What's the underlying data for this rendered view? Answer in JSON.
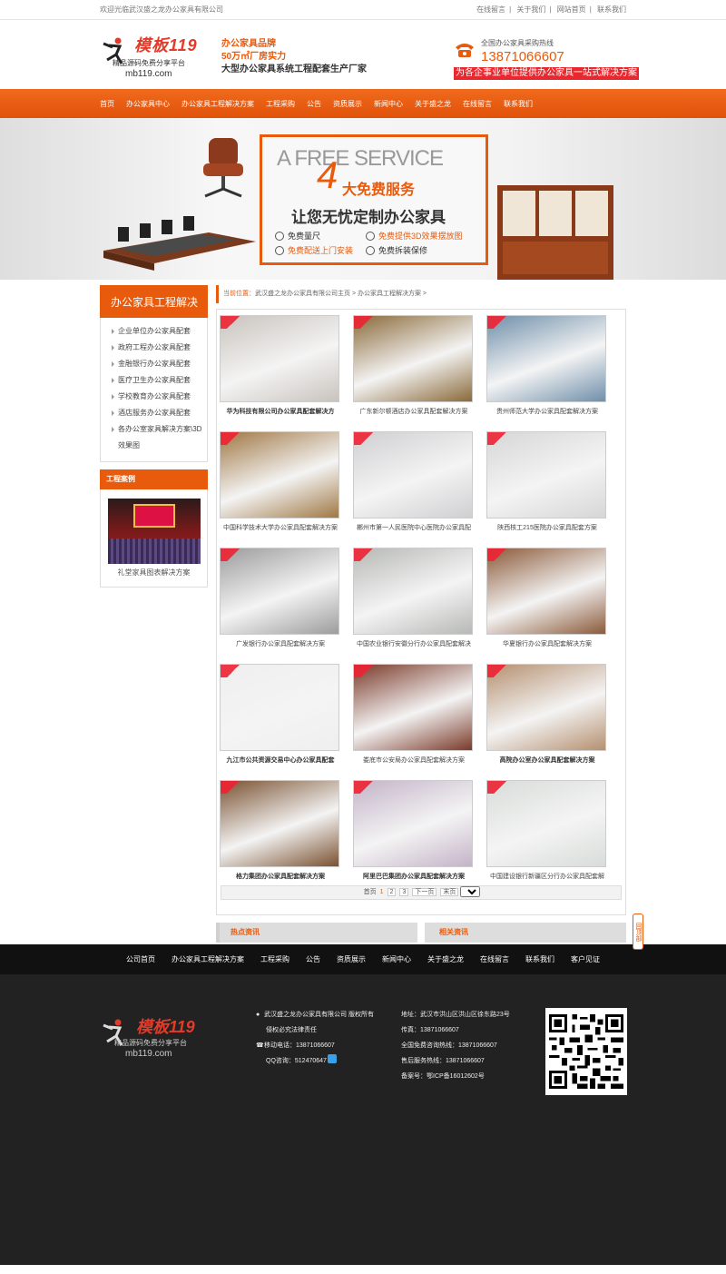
{
  "topbar": {
    "welcome": "欢迎光临武汉盛之龙办公家具有限公司",
    "links": [
      "在线留言",
      "关于我们",
      "网站首页",
      "联系我们"
    ]
  },
  "header": {
    "logo_brand": "模板119",
    "logo_tagline": "精品源码免费分享平台",
    "logo_url": "mb119.com",
    "slogan_line1": "办公家具品牌",
    "slogan_line2": "50万㎡厂房实力",
    "slogan_line3": "大型办公家具系统工程配套生产厂家",
    "hotline_label": "全国办公家具采购热线",
    "hotline_number": "13871066607",
    "hotline_banner": "为各企事业单位提供办公家具一站式解决方案"
  },
  "nav": [
    "首页",
    "办公家具中心",
    "办公家具工程解决方案",
    "工程采购",
    "公告",
    "资质展示",
    "新闻中心",
    "关于盛之龙",
    "在线留言",
    "联系我们"
  ],
  "banner": {
    "free_service": "A FREE SERVICE",
    "four": "4",
    "title": "大免费服务",
    "subtitle": "让您无忧定制办公家具",
    "features": [
      "免费量尺",
      "免费提供3D效果摆放图",
      "免费配送上门安装",
      "免费拆装保修"
    ]
  },
  "sidebar": {
    "title": "办公家具工程解决",
    "items": [
      "企业单位办公家具配套",
      "政府工程办公家具配套",
      "金融银行办公家具配套",
      "医疗卫生办公家具配套",
      "学校教育办公家具配套",
      "酒店服务办公家具配套",
      "各办公室家具解决方案\\3D效果图"
    ],
    "cases_title": "工程案例",
    "case_caption": "礼堂家具图表解决方案"
  },
  "breadcrumb": {
    "here": "当前位置：",
    "path": "武汉盛之龙办公家具有限公司主页 > 办公家具工程解决方案 >"
  },
  "cases": [
    {
      "caption": "华为科技有限公司办公家具配套解决方",
      "bold": true,
      "color": "#c9c3bd"
    },
    {
      "caption": "广东新尔顿酒店办公家具配套解决方案",
      "bold": false,
      "color": "#8a6a3a"
    },
    {
      "caption": "贵州师范大学办公家具配套解决方案",
      "bold": false,
      "color": "#6f8faa"
    },
    {
      "caption": "中国科学技术大学办公家具配套解决方案",
      "bold": false,
      "color": "#a07845"
    },
    {
      "caption": "郴州市第一人民医院中心医院办公家具配",
      "bold": false,
      "color": "#cfcfd2"
    },
    {
      "caption": "陕西核工215医院办公家具配套方案",
      "bold": false,
      "color": "#d6d6d6"
    },
    {
      "caption": "广发银行办公家具配套解决方案",
      "bold": false,
      "color": "#9c9c9c"
    },
    {
      "caption": "中国农业银行安徽分行办公家具配套解决",
      "bold": false,
      "color": "#b7b9b6"
    },
    {
      "caption": "华夏银行办公家具配套解决方案",
      "bold": false,
      "color": "#8b5a3a"
    },
    {
      "caption": "九江市公共资源交易中心办公家具配套",
      "bold": true,
      "color": "#efefef"
    },
    {
      "caption": "娄底市公安局办公家具配套解决方案",
      "bold": false,
      "color": "#7a3a2a"
    },
    {
      "caption": "高院办公室办公家具配套解决方案",
      "bold": true,
      "color": "#b59070"
    },
    {
      "caption": "格力集团办公家具配套解决方案",
      "bold": true,
      "color": "#7a5232"
    },
    {
      "caption": "阿里巴巴集团办公家具配套解决方案",
      "bold": true,
      "color": "#c4b3c8"
    },
    {
      "caption": "中国建设银行新疆区分行办公家具配套解",
      "bold": false,
      "color": "#d8dcd9"
    }
  ],
  "pager": {
    "first": "首页",
    "pages": [
      "1",
      "2",
      "3"
    ],
    "next": "下一页",
    "last": "末页",
    "select_value": "1"
  },
  "bottom_boxes": {
    "hot": "热点资讯",
    "related": "相关资讯"
  },
  "back_top": "回顶部",
  "footer_nav": [
    "公司首页",
    "办公家具工程解决方案",
    "工程采购",
    "公告",
    "资质展示",
    "新闻中心",
    "关于盛之龙",
    "在线留言",
    "联系我们",
    "客户见证"
  ],
  "footer": {
    "logo_brand": "模板119",
    "logo_tagline": "精品源码免费分享平台",
    "logo_url": "mb119.com",
    "col1": [
      "武汉盛之龙办公家具有限公司 版权所有",
      "侵权必究法律责任",
      "移动电话：13871066607",
      "QQ咨询：512470647"
    ],
    "col2": [
      "地址：武汉市洪山区洪山区徐东路23号",
      "传真：13871066607",
      "全国免费咨询热线：13871066607",
      "售后服务热线：13871066607",
      "备案号：鄂ICP备16012602号"
    ]
  },
  "colors": {
    "accent": "#e85a0c",
    "red": "#e8282e",
    "footer_bg": "#222222",
    "footnav_bg": "#111111"
  },
  "icons": [
    "phone-icon",
    "location-icon",
    "mobile-icon",
    "qq-icon",
    "qr-code-icon",
    "arrow-right-icon"
  ]
}
